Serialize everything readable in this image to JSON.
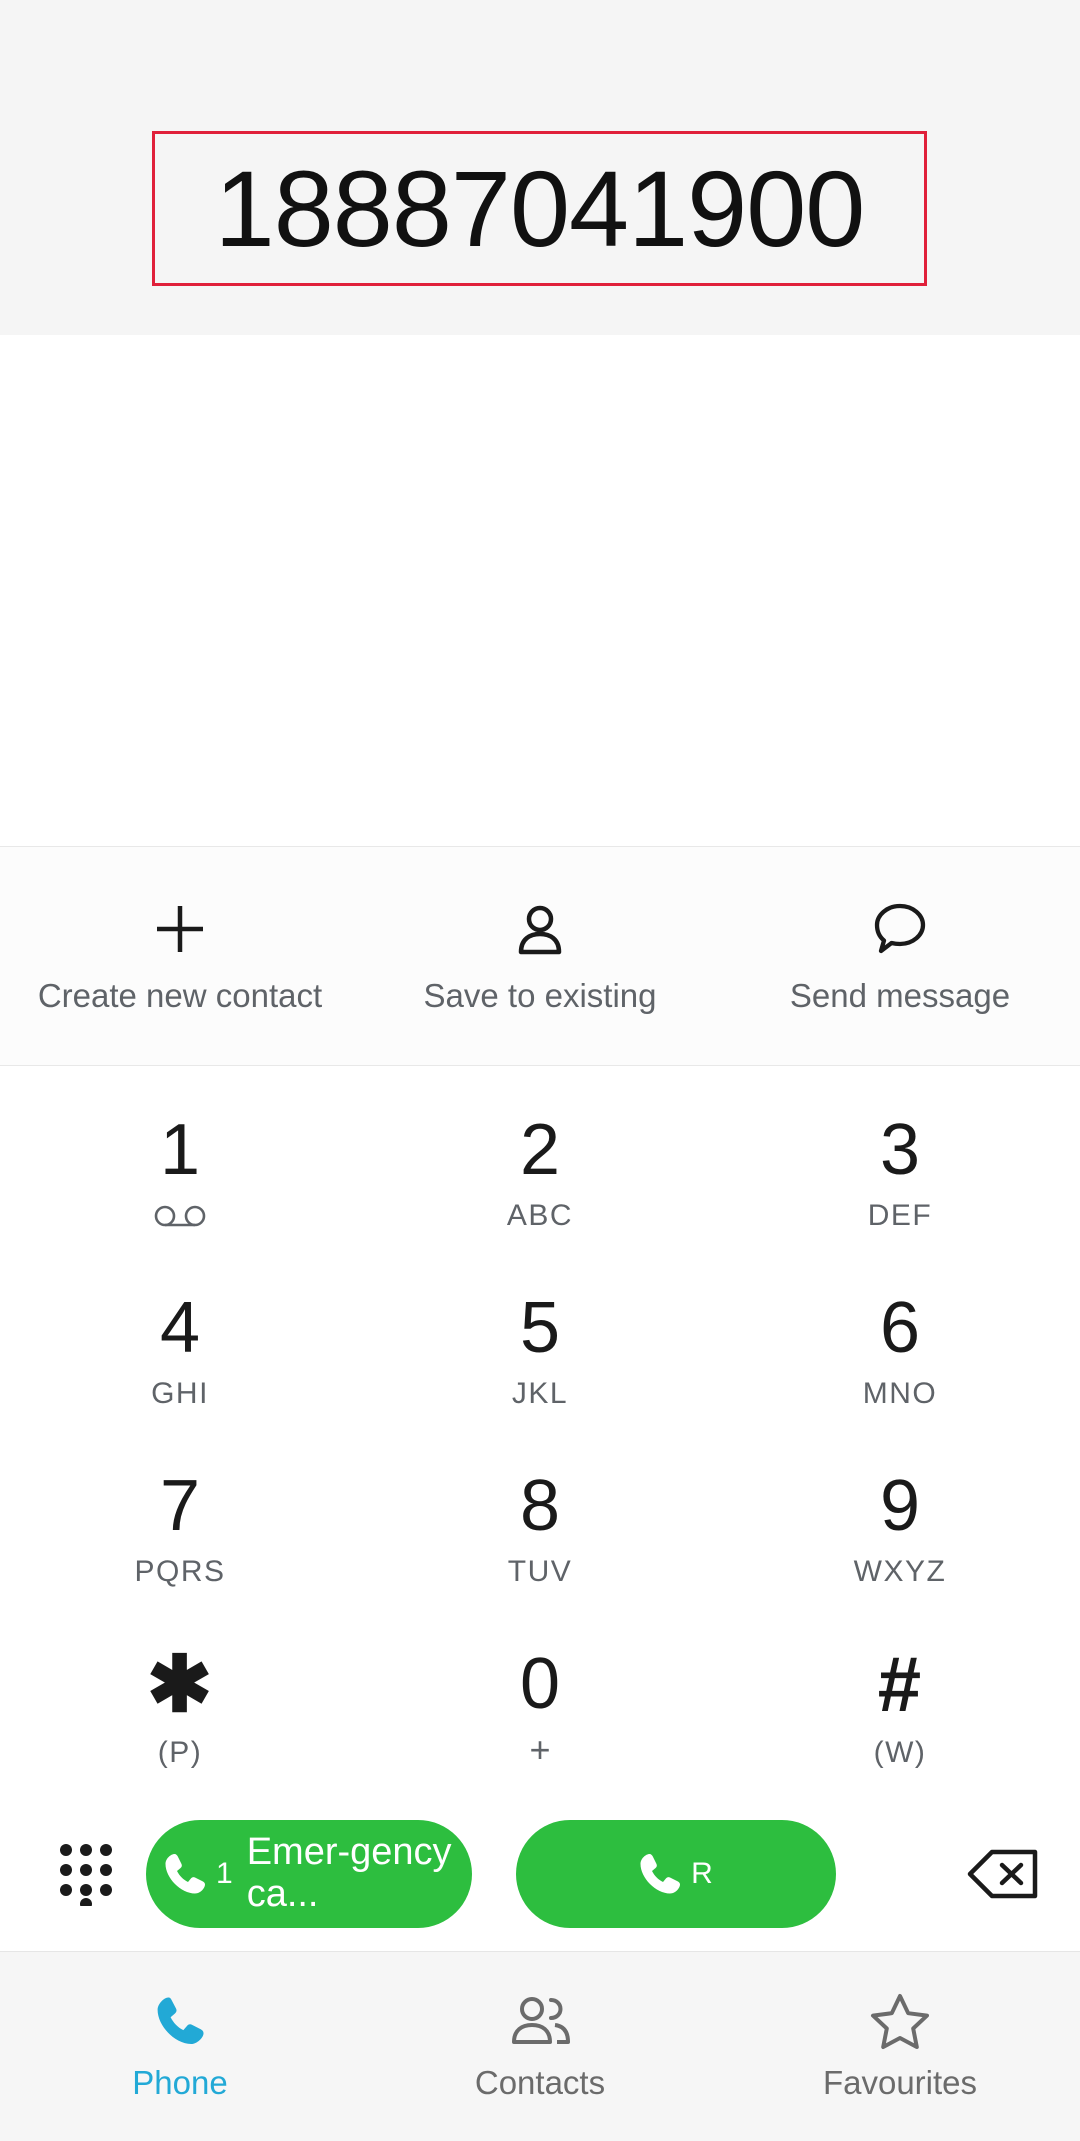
{
  "display": {
    "phone_number": "18887041900",
    "highlight_color": "#e0203a",
    "background": "#f5f5f5"
  },
  "quick_actions": [
    {
      "icon": "plus-icon",
      "label": "Create new contact"
    },
    {
      "icon": "person-icon",
      "label": "Save to existing"
    },
    {
      "icon": "message-bubble-icon",
      "label": "Send message"
    }
  ],
  "keypad": {
    "keys": [
      {
        "digit": "1",
        "sub": "",
        "sub_icon": "voicemail-icon"
      },
      {
        "digit": "2",
        "sub": "ABC",
        "sub_icon": ""
      },
      {
        "digit": "3",
        "sub": "DEF",
        "sub_icon": ""
      },
      {
        "digit": "4",
        "sub": "GHI",
        "sub_icon": ""
      },
      {
        "digit": "5",
        "sub": "JKL",
        "sub_icon": ""
      },
      {
        "digit": "6",
        "sub": "MNO",
        "sub_icon": ""
      },
      {
        "digit": "7",
        "sub": "PQRS",
        "sub_icon": ""
      },
      {
        "digit": "8",
        "sub": "TUV",
        "sub_icon": ""
      },
      {
        "digit": "9",
        "sub": "WXYZ",
        "sub_icon": ""
      },
      {
        "digit": "✱",
        "sub": "(P)",
        "sub_icon": ""
      },
      {
        "digit": "0",
        "sub": "+",
        "sub_icon": ""
      },
      {
        "digit": "#",
        "sub": "(W)",
        "sub_icon": ""
      }
    ]
  },
  "call_bar": {
    "dialpad_toggle_icon": "dialpad-icon",
    "primary_call": {
      "sim_label": "1",
      "label": "Emer-gency ca...",
      "color": "#2dbe3f",
      "icon": "phone-call-icon"
    },
    "secondary_call": {
      "sim_label": "R",
      "label": "",
      "color": "#2dbe3f",
      "icon": "phone-call-icon"
    },
    "backspace_icon": "backspace-icon"
  },
  "bottom_nav": {
    "active_color": "#22a9d6",
    "items": [
      {
        "icon": "phone-icon",
        "label": "Phone",
        "active": true
      },
      {
        "icon": "contacts-icon",
        "label": "Contacts",
        "active": false
      },
      {
        "icon": "star-icon",
        "label": "Favourites",
        "active": false
      }
    ]
  }
}
